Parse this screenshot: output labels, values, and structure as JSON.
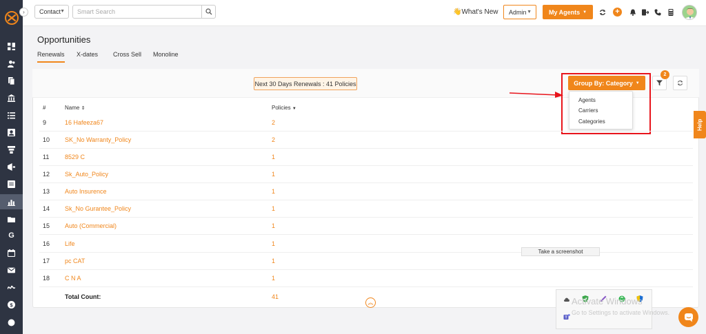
{
  "header": {
    "contact_select": "Contact",
    "search_placeholder": "Smart Search",
    "whats_new": "What's New",
    "whats_new_emoji": "👋",
    "admin_select": "Admin",
    "agents_button": "My Agents",
    "plus": "+"
  },
  "page": {
    "title": "Opportunities",
    "tabs": [
      "Renewals",
      "X-dates",
      "Cross Sell",
      "Monoline"
    ]
  },
  "toolbar": {
    "renewals_badge": "Next 30 Days Renewals : 41 Policies",
    "group_by": "Group By: Category",
    "group_options": [
      "Agents",
      "Carriers",
      "Categories"
    ],
    "filter_count": "2"
  },
  "table": {
    "headers": {
      "num": "#",
      "name": "Name",
      "policies": "Policies"
    },
    "rows": [
      {
        "num": "9",
        "name": "16 Hafeeza67",
        "policies": "2"
      },
      {
        "num": "10",
        "name": "SK_No Warranty_Policy",
        "policies": "2"
      },
      {
        "num": "11",
        "name": "8529 C",
        "policies": "1"
      },
      {
        "num": "12",
        "name": "Sk_Auto_Policy",
        "policies": "1"
      },
      {
        "num": "13",
        "name": "Auto Insurence",
        "policies": "1"
      },
      {
        "num": "14",
        "name": "Sk_No Gurantee_Policy",
        "policies": "1"
      },
      {
        "num": "15",
        "name": "Auto (Commercial)",
        "policies": "1"
      },
      {
        "num": "16",
        "name": "Life",
        "policies": "1"
      },
      {
        "num": "17",
        "name": "pc CAT",
        "policies": "1"
      },
      {
        "num": "18",
        "name": "C N A",
        "policies": "1"
      }
    ],
    "total_label": "Total Count:",
    "total_value": "41"
  },
  "help_tab": "Help",
  "tooltip": "Take a screenshot",
  "windows": {
    "title": "Activate Windows",
    "subtitle": "Go to Settings to activate Windows."
  },
  "colors": {
    "accent": "#f0861b",
    "sidebar": "#2e3442",
    "highlight": "#e8141b"
  }
}
